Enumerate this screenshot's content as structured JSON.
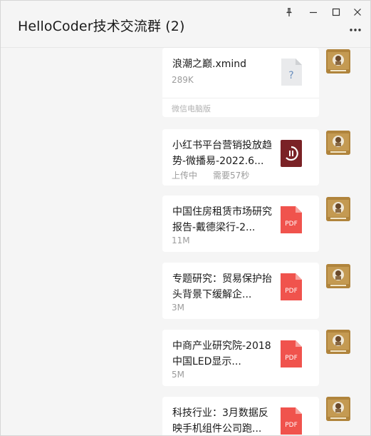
{
  "window": {
    "title": "HelloCoder技术交流群 (2)"
  },
  "colors": {
    "pdf": "#f0534d",
    "xmind_icon": "#e9eaec",
    "video_icon": "#7a2226",
    "bubble": "#ffffff",
    "background": "#f5f5f5"
  },
  "icons": {
    "pin": "pin-icon",
    "minimize": "minimize-icon",
    "maximize": "maximize-icon",
    "close": "close-icon",
    "more": "more-icon"
  },
  "messages": [
    {
      "filename": "浪潮之巅.xmind",
      "size": "289K",
      "source": "微信电脑版",
      "icon": "unknown-file-icon",
      "icon_label": "?"
    },
    {
      "filename": "小红书平台营销投放趋势-微播易-2022.6...",
      "status": "上传中",
      "remaining": "需要57秒",
      "icon": "uploading-file-icon"
    },
    {
      "filename": "中国住房租赁市场研究报告-戴德梁行-2...",
      "size": "11M",
      "icon": "pdf-icon",
      "icon_label": "PDF"
    },
    {
      "filename": "专题研究：贸易保护抬头背景下缓解企...",
      "size": "3M",
      "icon": "pdf-icon",
      "icon_label": "PDF"
    },
    {
      "filename": "中商产业研究院-2018中国LED显示...",
      "size": "5M",
      "icon": "pdf-icon",
      "icon_label": "PDF"
    },
    {
      "filename": "科技行业：3月数据反映手机组件公司跑...",
      "icon": "pdf-icon",
      "icon_label": "PDF"
    }
  ]
}
